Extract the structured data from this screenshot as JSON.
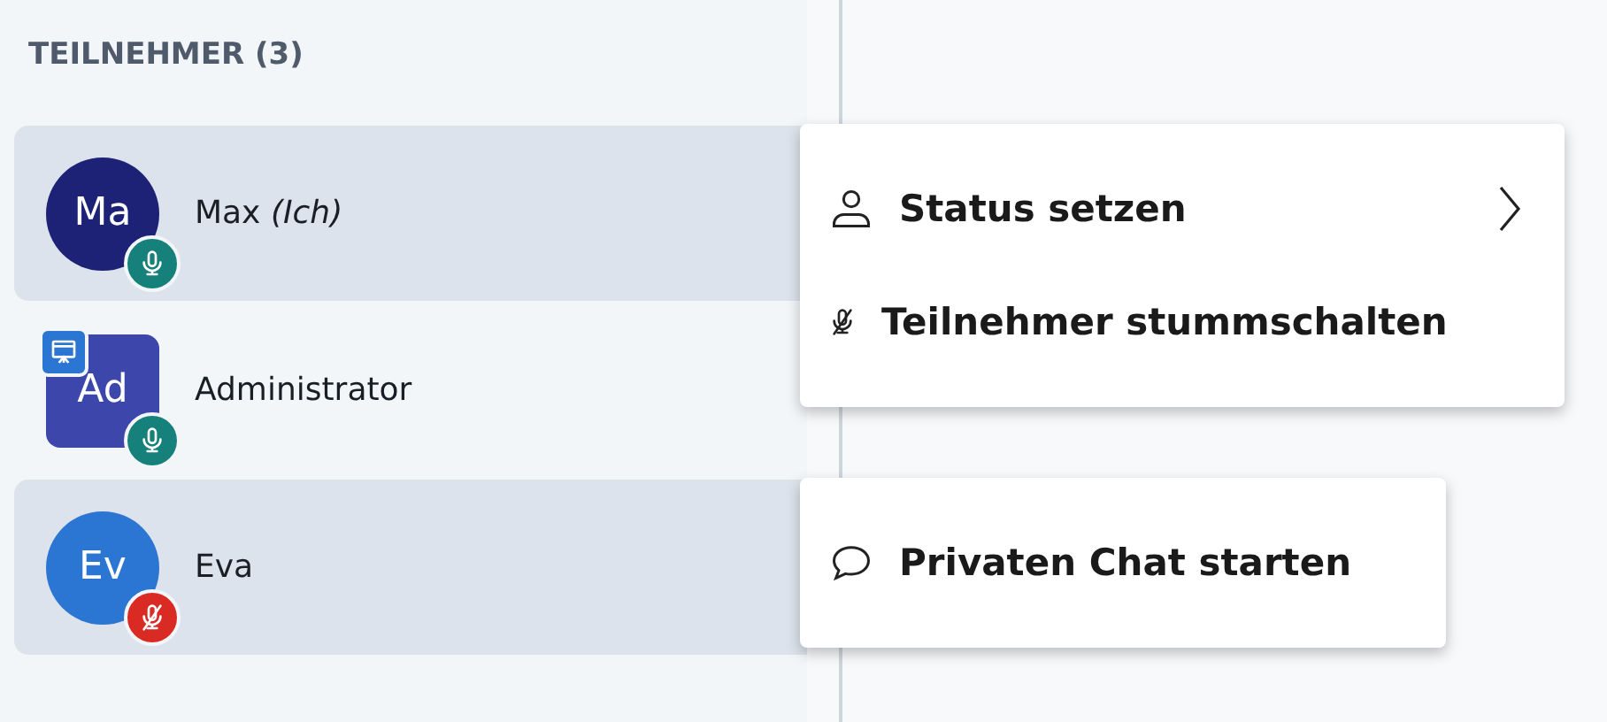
{
  "sidebar": {
    "heading": "TEILNEHMER (3)",
    "participants": [
      {
        "initials": "Ma",
        "name": "Max",
        "suffix": "(Ich)",
        "color": "#1d2277",
        "moderator": false,
        "presenter": false,
        "muted": false,
        "selected": true
      },
      {
        "initials": "Ad",
        "name": "Administrator",
        "color": "#3c46ab",
        "moderator": true,
        "presenter": true,
        "muted": false,
        "selected": false
      },
      {
        "initials": "Ev",
        "name": "Eva",
        "color": "#2b76d2",
        "moderator": false,
        "presenter": false,
        "muted": true,
        "selected": true
      }
    ]
  },
  "menus": [
    {
      "items": [
        {
          "kind": "person",
          "label": "Status setzen",
          "submenu": true
        },
        {
          "kind": "mute",
          "label": "Teilnehmer stummschalten",
          "submenu": false
        }
      ]
    },
    {
      "items": [
        {
          "kind": "chat",
          "label": "Privaten Chat starten",
          "submenu": false
        }
      ]
    }
  ]
}
